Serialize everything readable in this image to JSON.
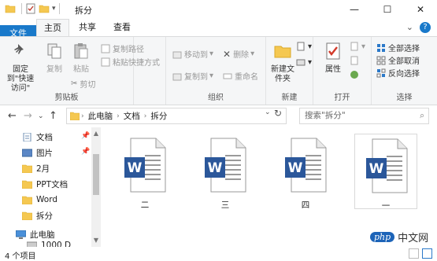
{
  "window": {
    "title": "拆分",
    "minimize": "—",
    "maximize": "☐",
    "close": "✕"
  },
  "tabs": {
    "file": "文件",
    "home": "主页",
    "share": "共享",
    "view": "查看"
  },
  "ribbon": {
    "clipboard": {
      "pin_label": "固定到\"快速访问\"",
      "copy_label": "复制",
      "paste_label": "粘贴",
      "copy_path": "复制路径",
      "paste_shortcut": "粘贴快捷方式",
      "cut": "剪切",
      "group_label": "剪贴板"
    },
    "organize": {
      "move_to": "移动到",
      "copy_to": "复制到",
      "delete": "删除",
      "rename": "重命名",
      "group_label": "组织"
    },
    "new": {
      "new_folder": "新建文件夹",
      "group_label": "新建"
    },
    "open": {
      "properties": "属性",
      "group_label": "打开"
    },
    "select": {
      "select_all": "全部选择",
      "select_none": "全部取消",
      "invert": "反向选择",
      "group_label": "选择"
    }
  },
  "address": {
    "crumbs": [
      "此电脑",
      "文档",
      "拆分"
    ],
    "search_placeholder": "搜索\"拆分\""
  },
  "sidebar": {
    "items": [
      {
        "label": "文档",
        "icon": "documents-icon",
        "pinned": true
      },
      {
        "label": "图片",
        "icon": "pictures-icon",
        "pinned": true
      },
      {
        "label": "2月",
        "icon": "folder-icon",
        "pinned": false
      },
      {
        "label": "PPT文档",
        "icon": "folder-icon",
        "pinned": false
      },
      {
        "label": "Word",
        "icon": "folder-icon",
        "pinned": false
      },
      {
        "label": "拆分",
        "icon": "folder-icon",
        "pinned": false
      },
      {
        "label": "此电脑",
        "icon": "computer-icon",
        "pinned": false
      },
      {
        "label": "1000 D",
        "icon": "drive-icon",
        "pinned": false
      }
    ]
  },
  "files": [
    {
      "name": "二",
      "selected": false
    },
    {
      "name": "三",
      "selected": false
    },
    {
      "name": "四",
      "selected": false
    },
    {
      "name": "一",
      "selected": true
    }
  ],
  "status": {
    "count": "4 个项目"
  },
  "watermark": {
    "brand": "php",
    "site": "中文网"
  },
  "colors": {
    "accent": "#1979ca",
    "word_blue": "#2b579a",
    "folder_yellow": "#f5c851"
  }
}
